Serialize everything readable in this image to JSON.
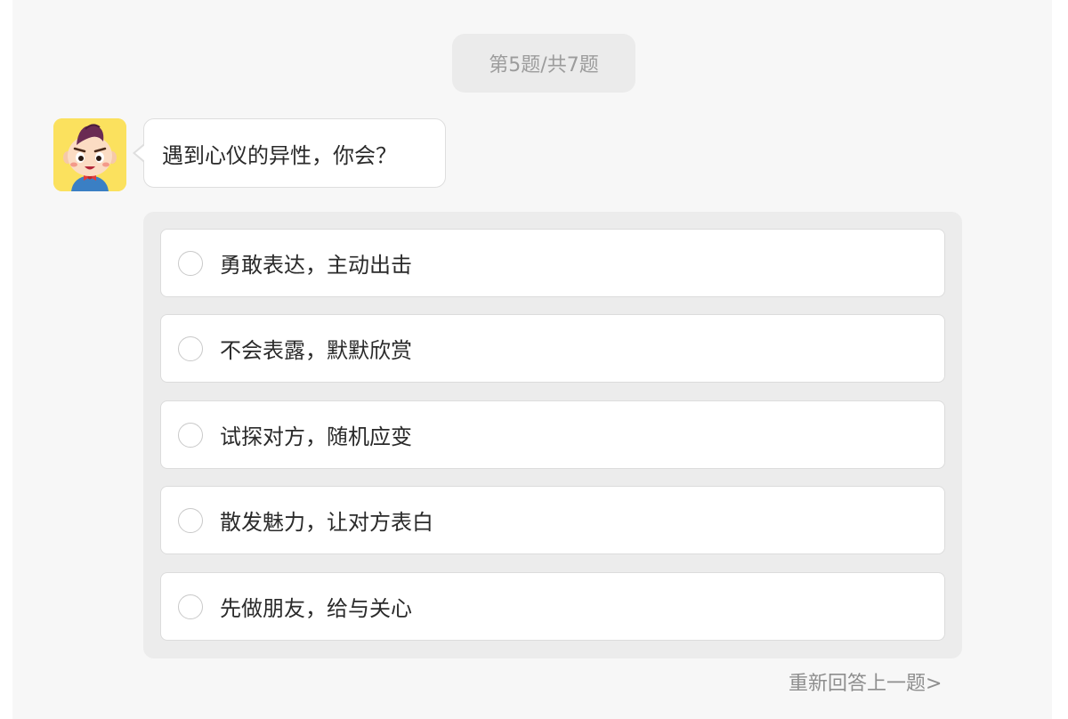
{
  "progress": {
    "label": "第5题/共7题"
  },
  "question": {
    "text": "遇到心仪的异性，你会？"
  },
  "options": [
    {
      "label": "勇敢表达，主动出击"
    },
    {
      "label": "不会表露，默默欣赏"
    },
    {
      "label": "试探对方，随机应变"
    },
    {
      "label": "散发魅力，让对方表白"
    },
    {
      "label": "先做朋友，给与关心"
    }
  ],
  "redo": {
    "label": "重新回答上一题>"
  },
  "colors": {
    "avatar_bg": "#fbe15e",
    "panel_bg": "#f7f7f7",
    "options_bg": "#ececec"
  }
}
